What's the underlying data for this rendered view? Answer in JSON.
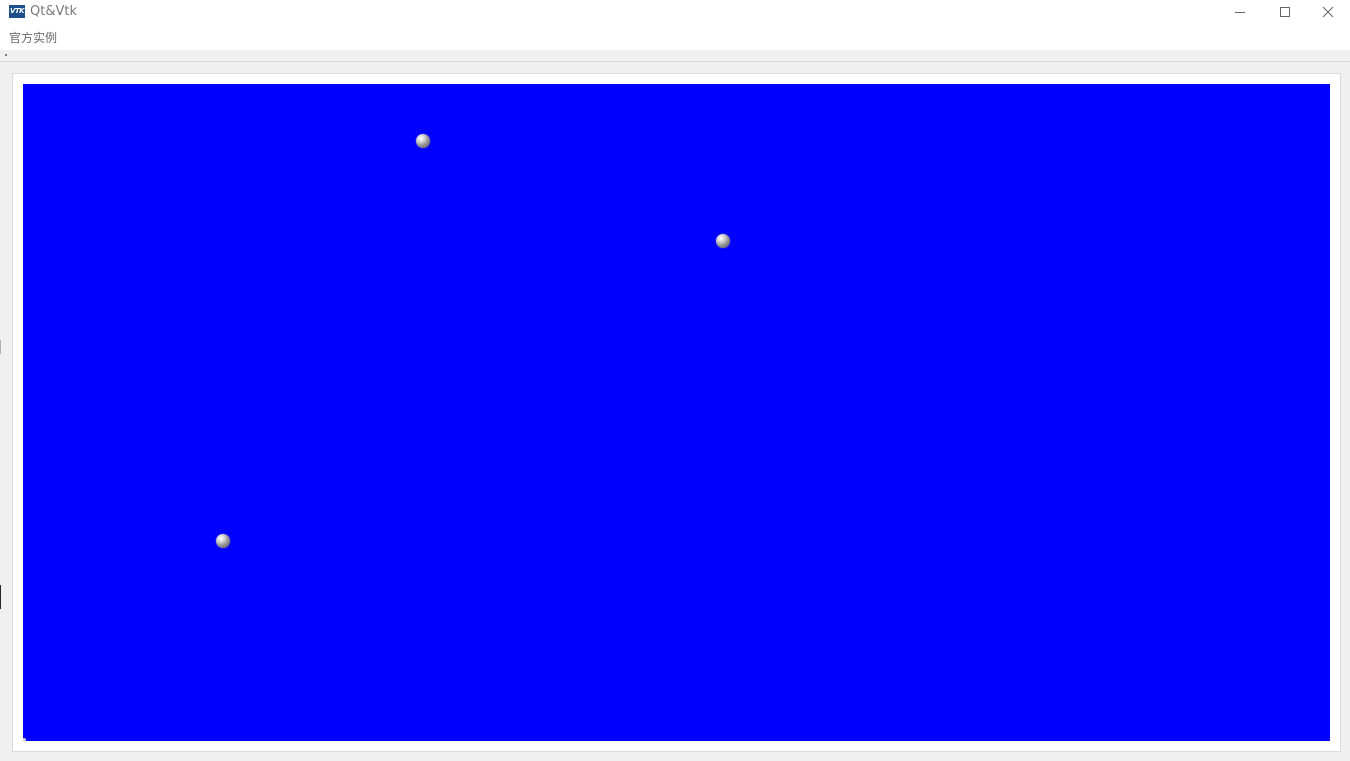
{
  "window": {
    "title": "Qt&Vtk",
    "icon": "vtk-logo-icon",
    "controls": [
      "minimize-icon",
      "maximize-icon",
      "close-icon"
    ]
  },
  "menubar": {
    "items": [
      {
        "label": "官方实例"
      }
    ]
  },
  "viewport": {
    "background_color": "#0000ff",
    "spheres": [
      {
        "name": "sphere-1",
        "color": "#a0a0a0"
      },
      {
        "name": "sphere-2",
        "color": "#a0a0a0"
      },
      {
        "name": "sphere-3",
        "color": "#a0a0a0"
      }
    ]
  },
  "colors": {
    "titlebar": "#ffffff",
    "frame_background": "#f0f0f0",
    "render_background": "#0000ff"
  }
}
